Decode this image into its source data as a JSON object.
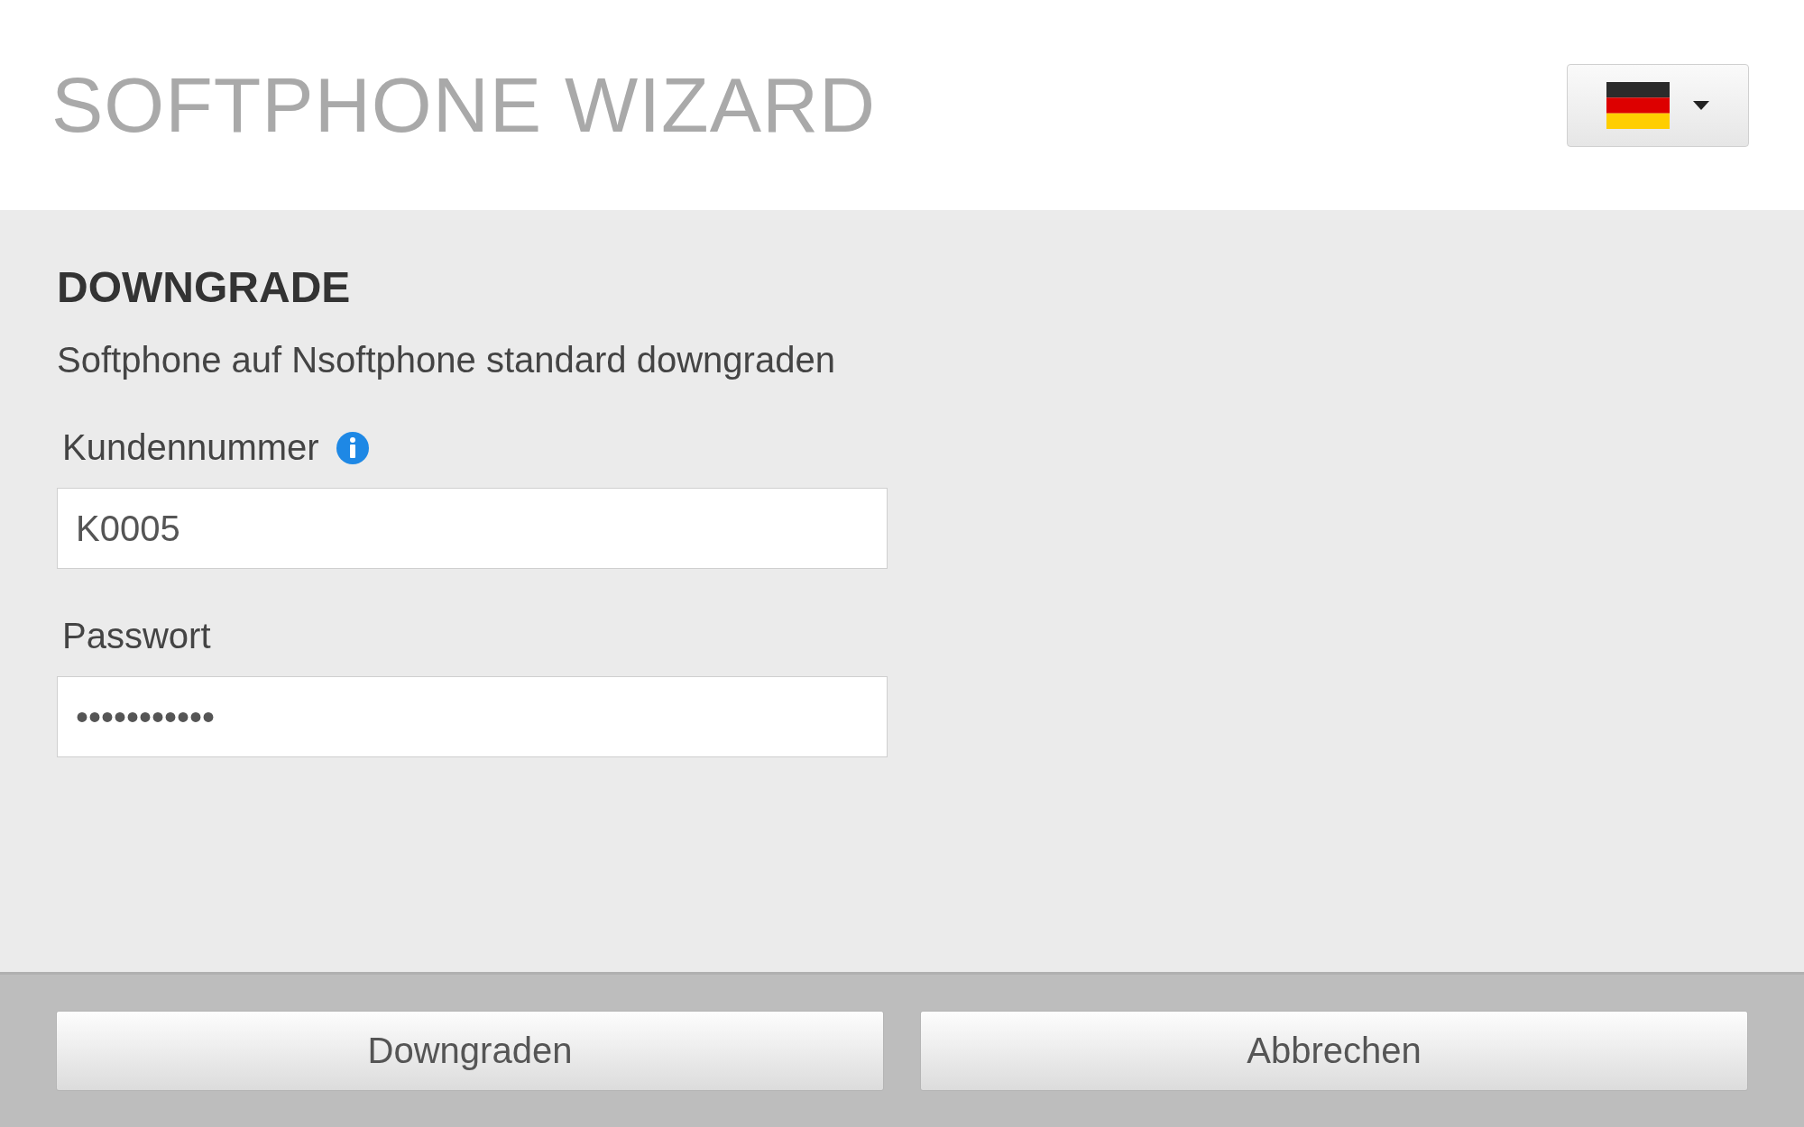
{
  "header": {
    "title": "SOFTPHONE WIZARD"
  },
  "section": {
    "heading": "DOWNGRADE",
    "description": "Softphone auf Nsoftphone standard downgraden"
  },
  "fields": [
    {
      "label": "Kundennummer",
      "info": true,
      "value": "K0005"
    },
    {
      "label": "Passwort",
      "info": false,
      "value": "•••••••••••"
    }
  ],
  "buttons": [
    {
      "label": "Downgraden"
    },
    {
      "label": "Abbrechen"
    }
  ]
}
